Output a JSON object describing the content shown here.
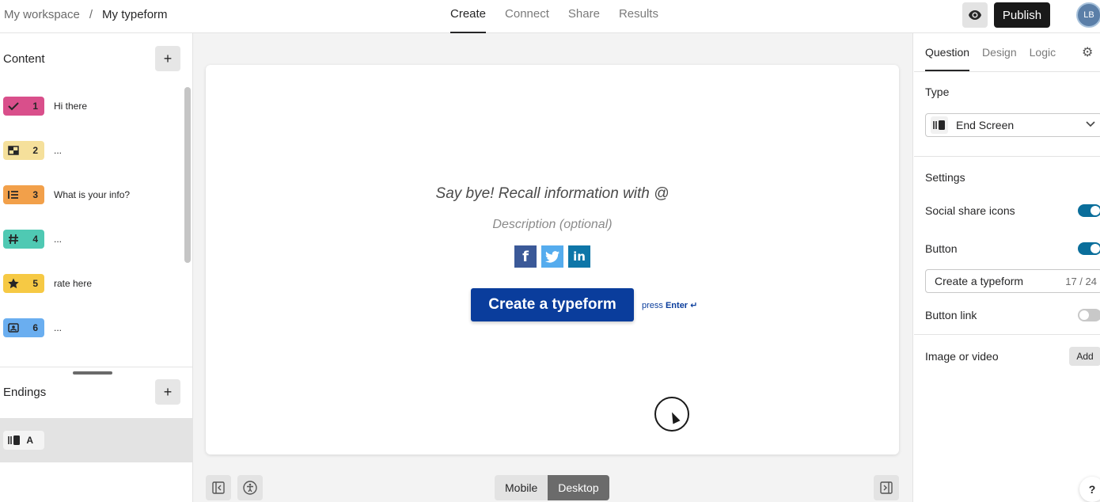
{
  "breadcrumb": {
    "workspace": "My workspace",
    "separator": "/",
    "form": "My typeform"
  },
  "nav": {
    "tabs": [
      "Create",
      "Connect",
      "Share",
      "Results"
    ],
    "active": "Create"
  },
  "header": {
    "publish_label": "Publish",
    "avatar_initials": "LB"
  },
  "left": {
    "content_title": "Content",
    "endings_title": "Endings",
    "questions": [
      {
        "number": "1",
        "label": "Hi there",
        "color": "#d94f8b",
        "icon": "check-icon"
      },
      {
        "number": "2",
        "label": "...",
        "color": "#f5e09b",
        "icon": "picture-choice-icon"
      },
      {
        "number": "3",
        "label": "What is your info?",
        "color": "#f2a04a",
        "icon": "list-icon"
      },
      {
        "number": "4",
        "label": "...",
        "color": "#4fc9b3",
        "icon": "hash-icon"
      },
      {
        "number": "5",
        "label": "rate here",
        "color": "#f6c944",
        "icon": "star-icon"
      },
      {
        "number": "6",
        "label": "...",
        "color": "#6aaef0",
        "icon": "contact-icon"
      }
    ],
    "ending": {
      "letter": "A"
    }
  },
  "card": {
    "title": "Say bye! Recall information with @",
    "description": "Description (optional)",
    "button_label": "Create a typeform",
    "press_text": "press",
    "enter_text": "Enter ↵"
  },
  "footer": {
    "mobile_label": "Mobile",
    "desktop_label": "Desktop",
    "active": "Desktop"
  },
  "right": {
    "tabs": [
      "Question",
      "Design",
      "Logic"
    ],
    "active_tab": "Question",
    "type_label": "Type",
    "type_value": "End Screen",
    "settings_label": "Settings",
    "social_share_label": "Social share icons",
    "social_share_on": true,
    "button_label": "Button",
    "button_on": true,
    "button_text_value": "Create a typeform",
    "button_text_count": "17 / 24",
    "button_link_label": "Button link",
    "button_link_on": false,
    "image_video_label": "Image or video",
    "add_label": "Add",
    "help_label": "?"
  }
}
